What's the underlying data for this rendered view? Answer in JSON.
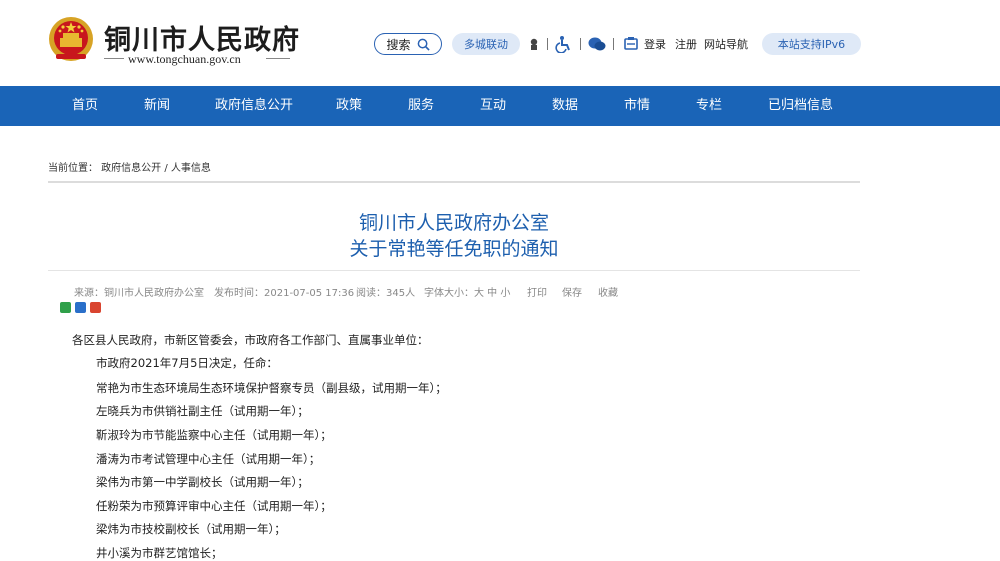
{
  "header": {
    "site_title": "铜川市人民政府",
    "site_url": "www.tongchuan.gov.cn",
    "search_label": "搜索",
    "region_link": "多城联动",
    "login": "登录",
    "register": "注册",
    "site_nav": "网站导航",
    "ipv6": "本站支持IPv6"
  },
  "nav": [
    "首页",
    "新闻",
    "政府信息公开",
    "政策",
    "服务",
    "互动",
    "数据",
    "市情",
    "专栏",
    "已归档信息"
  ],
  "breadcrumb": "当前位置： 政府信息公开 / 人事信息",
  "article": {
    "title_line1": "铜川市人民政府办公室",
    "title_line2": "关于常艳等任免职的通知",
    "meta": {
      "source": "来源：铜川市人民政府办公室",
      "date": "发布时间：2021-07-05 17:36",
      "views": "阅读：345人",
      "font_size_label": "字体大小：大 中 小",
      "print": "打印",
      "save": "保存",
      "favorite": "收藏"
    },
    "salutation": "各区县人民政府，市新区管委会，市政府各工作部门、直属事业单位：",
    "paragraphs": [
      "市政府2021年7月5日决定，任命：",
      "常艳为市生态环境局生态环境保护督察专员（副县级，试用期一年）；",
      "左晓兵为市供销社副主任（试用期一年）；",
      "靳淑玲为市节能监察中心主任（试用期一年）；",
      "潘涛为市考试管理中心主任（试用期一年）；",
      "梁伟为市第一中学副校长（试用期一年）；",
      "任粉荣为市预算评审中心主任（试用期一年）；",
      "梁炜为市技校副校长（试用期一年）；",
      "井小溪为市群艺馆馆长；"
    ]
  },
  "colors": {
    "nav_bg": "#1a64b7",
    "title_blue": "#1d5fae",
    "pill_bg": "#dfe9f7"
  }
}
